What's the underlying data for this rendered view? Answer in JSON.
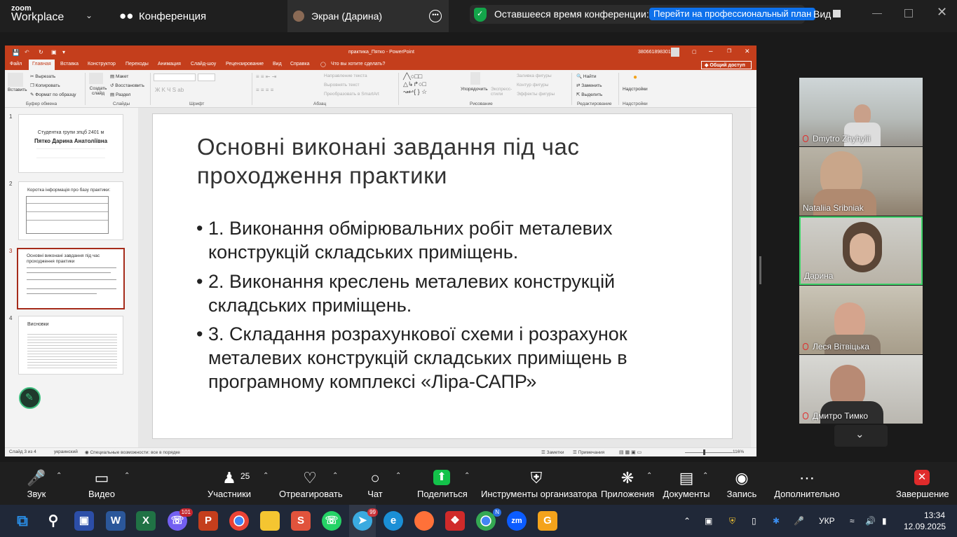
{
  "zoom": {
    "logo_top": "zoom",
    "logo_bottom": "Workplace",
    "conference_label": "Конференция",
    "screen_share_label": "Экран (Дарина)",
    "time_left": "Оставшееся время конференции: 05:26",
    "upgrade_label": "Перейти на профессиональный план",
    "view_label": "Вид"
  },
  "ppt": {
    "title": "практика_Пятко  -  PowerPoint",
    "account": "380661898301",
    "share_label": "Общий доступ",
    "tabs": [
      "Файл",
      "Главная",
      "Вставка",
      "Конструктор",
      "Переходы",
      "Анимация",
      "Слайд-шоу",
      "Рецензирование",
      "Вид",
      "Справка",
      "Что вы хотите сделать?"
    ],
    "ribbon": {
      "paste": "Вставить",
      "cut": "Вырезать",
      "copy": "Копировать",
      "format_painter": "Формат по образцу",
      "clipboard_group": "Буфер обмена",
      "new_slide": "Создать слайд",
      "layout": "Макет",
      "reset": "Восстановить",
      "section": "Раздел",
      "slides_group": "Слайды",
      "font_group": "Шрифт",
      "text_direction": "Направление текста",
      "align_text": "Выровнять текст",
      "smartart": "Преобразовать в SmartArt",
      "paragraph_group": "Абзац",
      "arrange": "Упорядочить",
      "quick_styles": "Экспресс-стили",
      "shape_fill": "Заливка фигуры",
      "shape_outline": "Контур фигуры",
      "shape_effects": "Эффекты фигуры",
      "drawing_group": "Рисование",
      "find": "Найти",
      "replace": "Заменить",
      "select": "Выделить",
      "editing_group": "Редактирование",
      "addins": "Надстройки",
      "addins_group": "Надстройки"
    },
    "thumbs": [
      {
        "num": "1",
        "title": "Студентка групи зпцб 2401 м",
        "subtitle": "Пятко Дарина Анатоліївна"
      },
      {
        "num": "2",
        "title": "Коротка інформація про базу практики:"
      },
      {
        "num": "3",
        "title": "Основні виконані завдання під час проходження практики"
      },
      {
        "num": "4",
        "title": "Висновки"
      }
    ],
    "slide": {
      "title": "Основні виконані завдання під час проходження практики",
      "bullets": [
        "1. Виконання обмірювальних робіт металевих конструкцій складських приміщень.",
        "2. Виконання креслень металевих конструкцій складських приміщень.",
        "3. Складання розрахункової схеми і розрахунок металевих конструкцій складських приміщень в програмному комплексі «Ліра-САПР»"
      ]
    },
    "status": {
      "slide_of": "Слайд 3 из 4",
      "language": "украинский",
      "accessibility": "Специальные возможности: все в порядке",
      "notes": "Заметки",
      "comments": "Примечания",
      "zoom": "116%"
    }
  },
  "participants_video": [
    {
      "name": "Dmytro Zhyhylii",
      "muted": true
    },
    {
      "name": "Nataliia Sribniak",
      "muted": false
    },
    {
      "name": "Дарина",
      "muted": false,
      "active": true
    },
    {
      "name": "Леся Вітвіцька",
      "muted": true
    },
    {
      "name": "Дмитро Тимко",
      "muted": true
    }
  ],
  "toolbar": {
    "audio": "Звук",
    "video": "Видео",
    "participants": "Участники",
    "participants_count": "25",
    "react": "Отреагировать",
    "chat": "Чат",
    "share": "Поделиться",
    "host_tools": "Инструменты организатора",
    "apps": "Приложения",
    "docs": "Документы",
    "record": "Запись",
    "more": "Дополнительно",
    "end": "Завершение"
  },
  "taskbar": {
    "viber_badge": "101",
    "telegram_badge": "99",
    "chrome_badge": "N",
    "lang": "УКР",
    "time": "13:34",
    "date": "12.09.2025"
  },
  "colors": {
    "ppt_accent": "#c43e1c",
    "zoom_blue": "#0e71eb",
    "active_speaker": "#3fd46a",
    "end_red": "#e02b2b"
  }
}
